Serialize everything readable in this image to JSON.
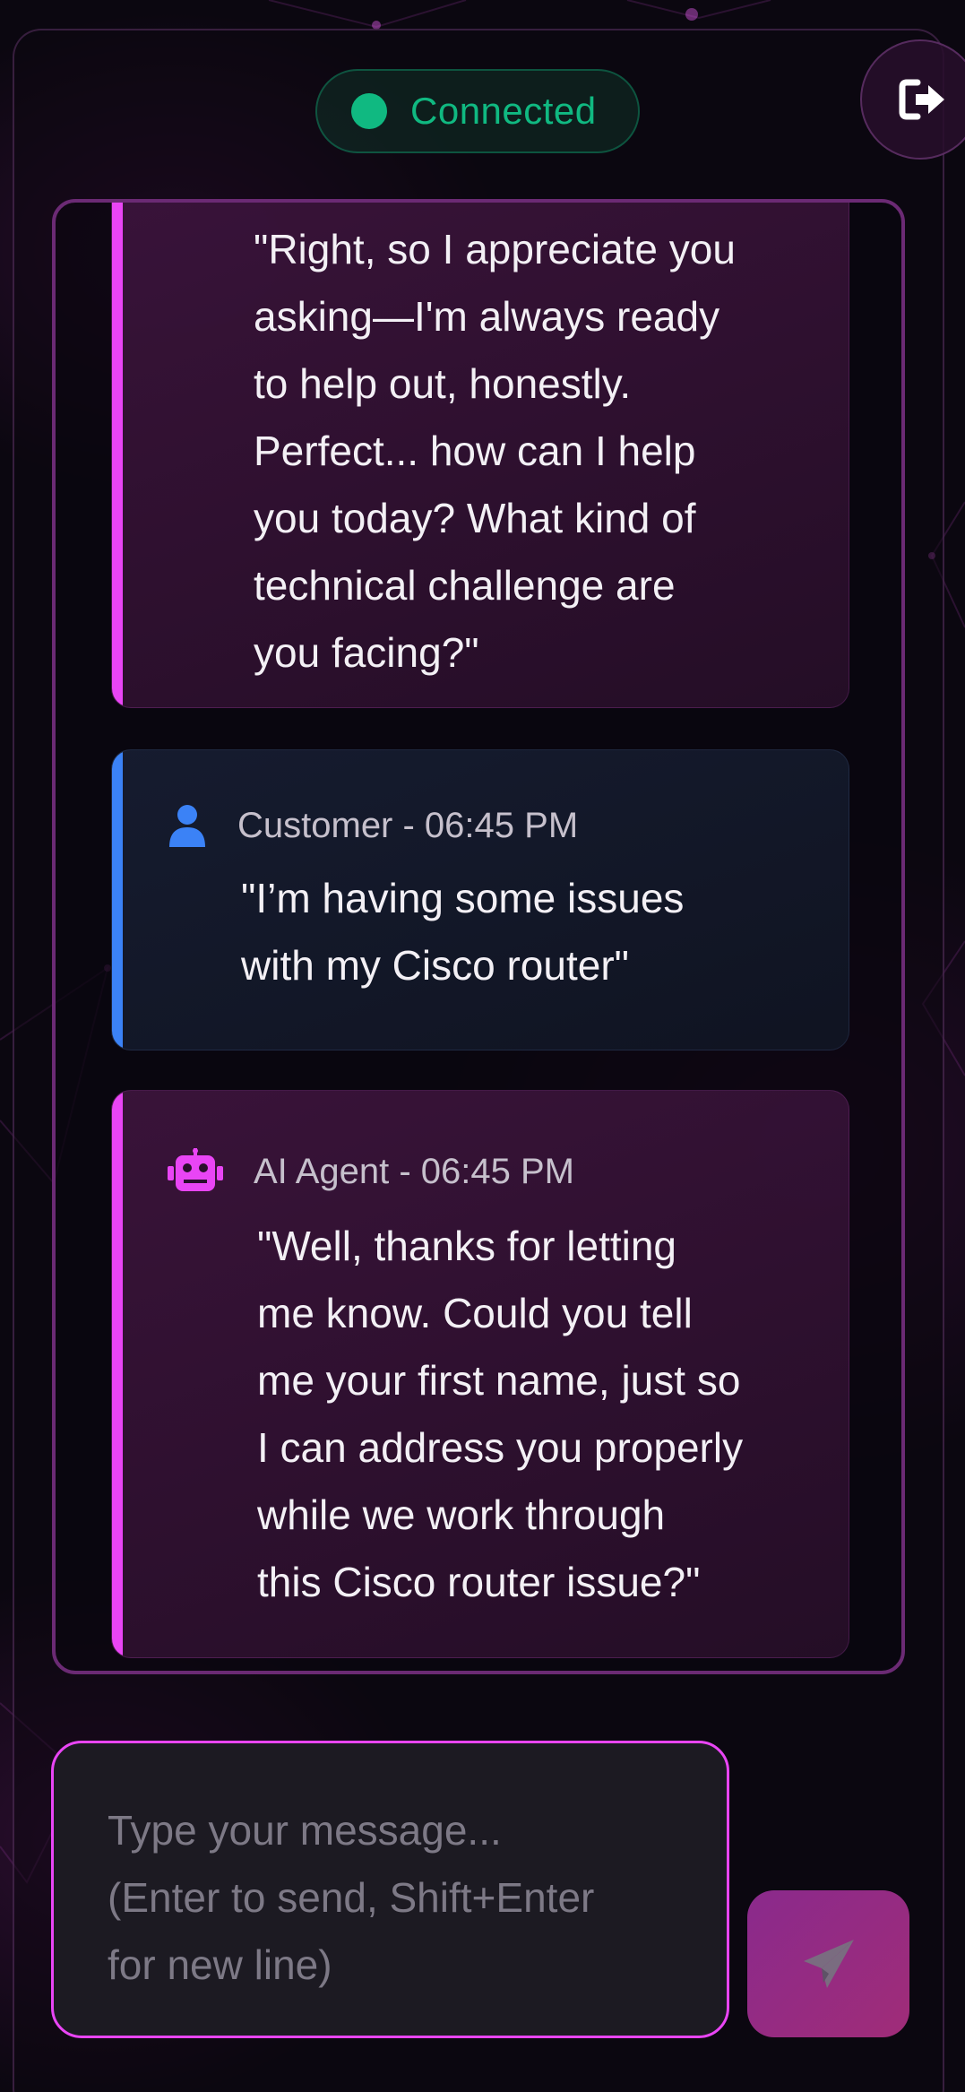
{
  "status": {
    "label": "Connected",
    "color": "#10b981"
  },
  "header": {
    "logout_icon": "logout-icon"
  },
  "messages": [
    {
      "role": "ai",
      "meta": "",
      "text": "\"Right, so I appreciate you asking—I'm always ready to help out, honestly. Perfect... how can I help you today? What kind of technical challenge are you facing?\"",
      "lines": [
        "\"Right, so I appreciate you",
        "asking—I'm always ready",
        "to help out, honestly.",
        "Perfect... how can I help",
        "you today? What kind of",
        "technical challenge are",
        "you facing?\""
      ]
    },
    {
      "role": "customer",
      "meta": "Customer - 06:45 PM",
      "icon": "user-icon",
      "lines": [
        "\"I’m having some issues",
        "with my Cisco router\""
      ]
    },
    {
      "role": "ai",
      "meta": "AI Agent - 06:45 PM",
      "icon": "robot-icon",
      "lines": [
        "\"Well, thanks for letting",
        "me know. Could you tell",
        "me your first name, just so",
        "I can address you properly",
        "while we work through",
        "this Cisco router issue?\""
      ]
    }
  ],
  "composer": {
    "placeholder": "Type your message...\n(Enter to send, Shift+Enter\nfor new line)",
    "value": ""
  },
  "send_button": {
    "icon": "send-icon"
  },
  "colors": {
    "ai_accent": "#e945f5",
    "customer_accent": "#3b82f6",
    "panel_border": "#6b2a74",
    "connected": "#10b981"
  }
}
